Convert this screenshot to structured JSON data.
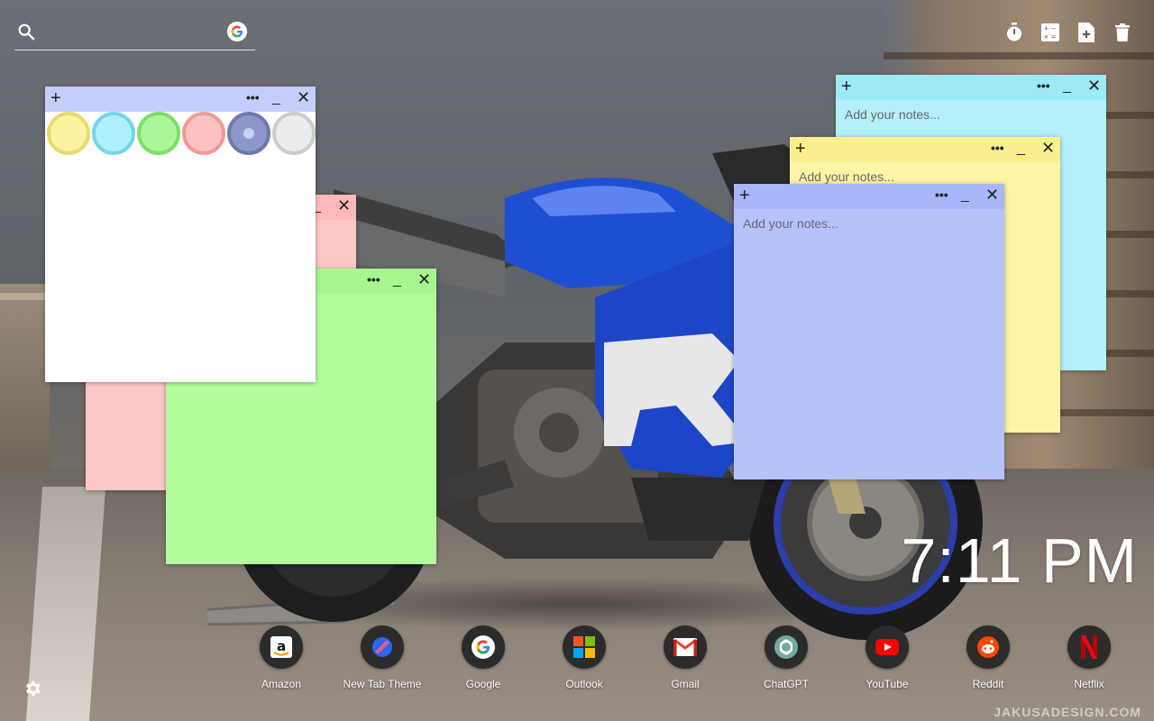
{
  "search": {
    "placeholder": "",
    "icon": "search-icon",
    "engine_icon": "google-g-icon"
  },
  "toolbar": {
    "items": [
      {
        "name": "timer",
        "icon": "stopwatch-icon"
      },
      {
        "name": "calculator",
        "icon": "calculator-icon"
      },
      {
        "name": "new-note",
        "icon": "note-add-icon"
      },
      {
        "name": "delete",
        "icon": "trash-icon"
      }
    ]
  },
  "notes": [
    {
      "id": "cyan",
      "color": "#b3f0f9",
      "bar_color": "#9ee9f6",
      "placeholder": "Add your notes...",
      "plus": "+",
      "more": "•••",
      "min": "_",
      "close": "✕"
    },
    {
      "id": "yellow",
      "color": "#fdf4a6",
      "bar_color": "#faef8e",
      "placeholder": "Add your notes...",
      "plus": "+",
      "more": "•••",
      "min": "_",
      "close": "✕"
    },
    {
      "id": "blue",
      "color": "#b6c3fb",
      "bar_color": "#a8b6fa",
      "placeholder": "Add your notes...",
      "plus": "+",
      "more": "•••",
      "min": "_",
      "close": "✕"
    },
    {
      "id": "pink",
      "color": "#ffc6c6",
      "bar_color": "#ffb9b9",
      "placeholder": "",
      "plus": "",
      "more": "",
      "min": "_",
      "close": "✕"
    },
    {
      "id": "green",
      "color": "#b2fc9e",
      "bar_color": "#a6f78f",
      "placeholder": "",
      "plus": "",
      "more": "•••",
      "min": "_",
      "close": "✕"
    },
    {
      "id": "white",
      "color": "#ffffff",
      "bar_color": "#c5cdfa",
      "placeholder": "",
      "plus": "+",
      "more": "•••",
      "min": "_",
      "close": "✕"
    }
  ],
  "palette": [
    {
      "name": "yellow",
      "fill": "#fdf3a3",
      "ring": "#e6dc6c"
    },
    {
      "name": "cyan",
      "fill": "#aef0fb",
      "ring": "#74d6e6"
    },
    {
      "name": "green",
      "fill": "#adf59a",
      "ring": "#7dde63"
    },
    {
      "name": "pink",
      "fill": "#fcc2c2",
      "ring": "#ee9a9a"
    },
    {
      "name": "blue",
      "fill": "#8d97c9",
      "ring": "#6e78ae",
      "selected": true
    },
    {
      "name": "white",
      "fill": "#ececec",
      "ring": "#cccccc"
    }
  ],
  "clock": {
    "time": "7:11 PM"
  },
  "dock": [
    {
      "label": "Amazon",
      "icon": "amazon-icon"
    },
    {
      "label": "New Tab Theme",
      "icon": "new-tab-theme-icon"
    },
    {
      "label": "Google",
      "icon": "google-icon"
    },
    {
      "label": "Outlook",
      "icon": "outlook-icon"
    },
    {
      "label": "Gmail",
      "icon": "gmail-icon"
    },
    {
      "label": "ChatGPT",
      "icon": "chatgpt-icon"
    },
    {
      "label": "YouTube",
      "icon": "youtube-icon"
    },
    {
      "label": "Reddit",
      "icon": "reddit-icon"
    },
    {
      "label": "Netflix",
      "icon": "netflix-icon"
    }
  ],
  "settings": {
    "icon": "gear-icon"
  },
  "watermark": "JAKUSADESIGN.COM",
  "colors": {
    "accent_blue": "#1f4fd1",
    "text_white": "#ffffff"
  }
}
